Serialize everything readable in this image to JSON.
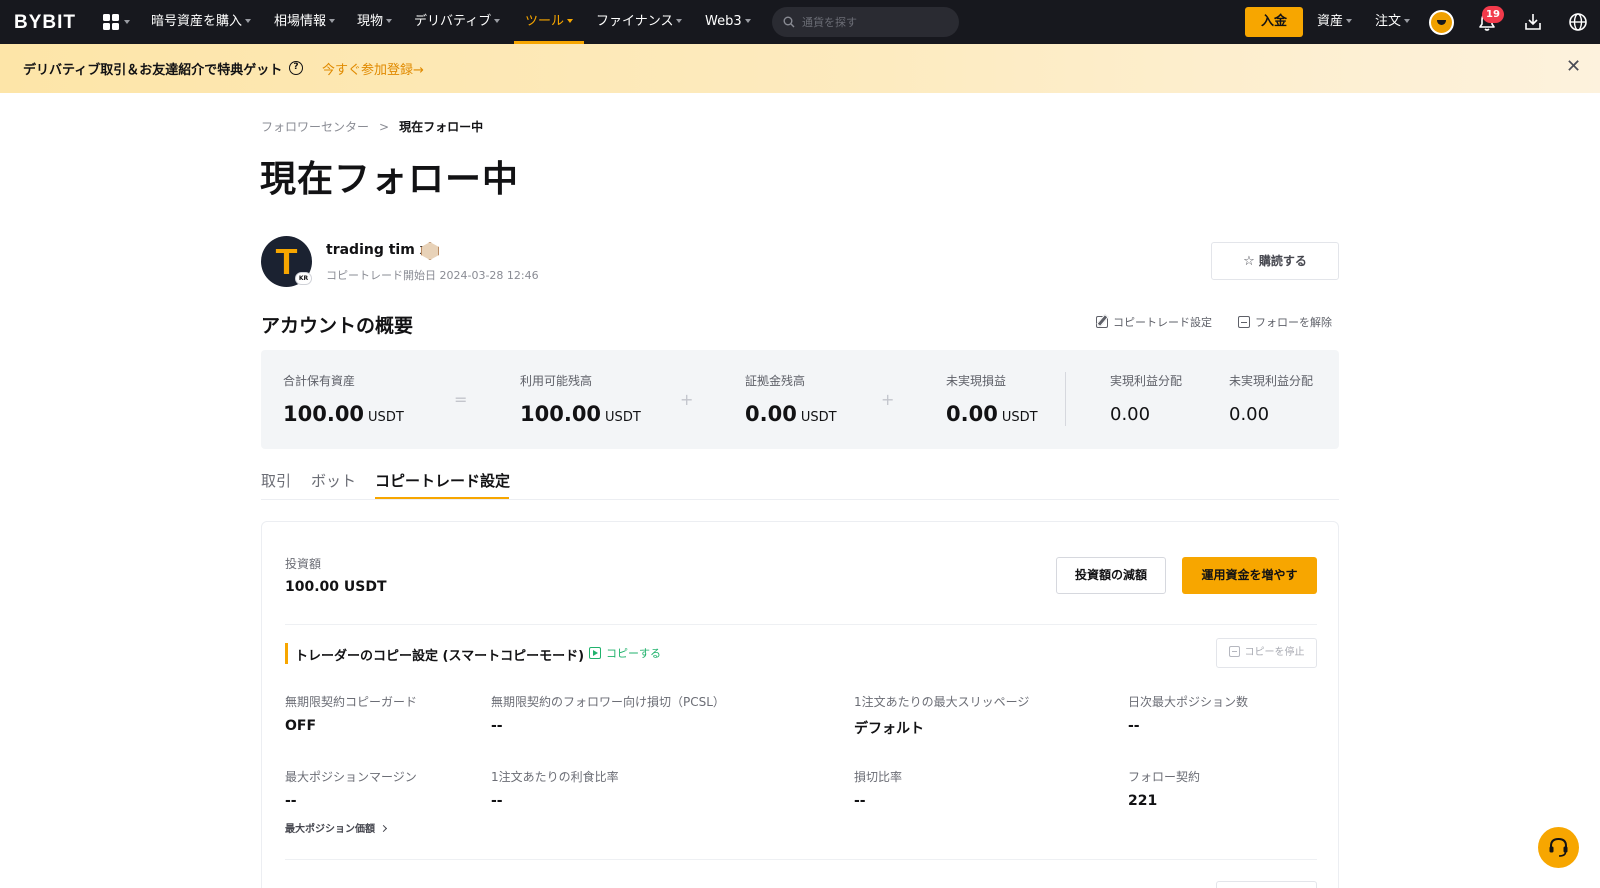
{
  "nav": {
    "logo": "BYBIT",
    "items": [
      {
        "label": "暗号資産を購入"
      },
      {
        "label": "相場情報"
      },
      {
        "label": "現物"
      },
      {
        "label": "デリバティブ"
      },
      {
        "label": "ツール"
      },
      {
        "label": "ファイナンス"
      },
      {
        "label": "Web3"
      }
    ],
    "active_item": "ツール",
    "search_placeholder": "通貨を探す",
    "deposit_label": "入金",
    "assets_label": "資産",
    "orders_label": "注文",
    "notification_count": "19",
    "accent_color": "#f7a600"
  },
  "banner": {
    "text": "デリバティブ取引＆お友達紹介で特典ゲット",
    "help_glyph": "?",
    "link_label": "今すぐ参加登録",
    "link_arrow": "→",
    "close_glyph": "✕"
  },
  "breadcrumb": {
    "parent": "フォロワーセンター",
    "separator": ">",
    "current": "現在フォロー中"
  },
  "page_title": "現在フォロー中",
  "trader": {
    "avatar_letter": "T",
    "region": "KR",
    "name": "trading tim x",
    "since_label": "コピートレード開始日",
    "since_value": "2024-03-28 12:46",
    "subscribe_label": "購読する"
  },
  "overview": {
    "title": "アカウントの概要",
    "settings_link": "コピートレード設定",
    "unfollow_link": "フォローを解除",
    "operators": [
      "=",
      "+",
      "+"
    ],
    "items": [
      {
        "label": "合計保有資産",
        "value": "100.00",
        "unit": "USDT"
      },
      {
        "label": "利用可能残高",
        "value": "100.00",
        "unit": "USDT"
      },
      {
        "label": "証拠金残高",
        "value": "0.00",
        "unit": "USDT"
      },
      {
        "label": "未実現損益",
        "value": "0.00",
        "unit": "USDT"
      },
      {
        "label": "実現利益分配",
        "value": "0.00"
      },
      {
        "label": "未実現利益分配",
        "value": "0.00"
      }
    ]
  },
  "tabs": [
    {
      "label": "取引"
    },
    {
      "label": "ボット"
    },
    {
      "label": "コピートレード設定"
    }
  ],
  "active_tab": "コピートレード設定",
  "investment": {
    "label": "投資額",
    "value": "100.00 USDT",
    "reduce_label": "投資額の減額",
    "increase_label": "運用資金を増やす"
  },
  "copy_settings": {
    "title": "トレーダーのコピー設定 (スマートコピーモード)",
    "copy_link": "コピーする",
    "stop_label": "コピーを停止",
    "fields": [
      {
        "label": "無期限契約コピーガード",
        "value": "OFF"
      },
      {
        "label": "無期限契約のフォロワー向け損切（PCSL）",
        "value": "--"
      },
      {
        "label": "1注文あたりの最大スリッページ",
        "value": "デフォルト"
      },
      {
        "label": "日次最大ポジション数",
        "value": "--"
      },
      {
        "label": "最大ポジションマージン",
        "value": "--"
      },
      {
        "label": "1注文あたりの利食比率",
        "value": "--"
      },
      {
        "label": "損切比率",
        "value": "--"
      },
      {
        "label": "フォロー契約",
        "value": "221"
      }
    ],
    "max_position_link": "最大ポジション価額"
  }
}
